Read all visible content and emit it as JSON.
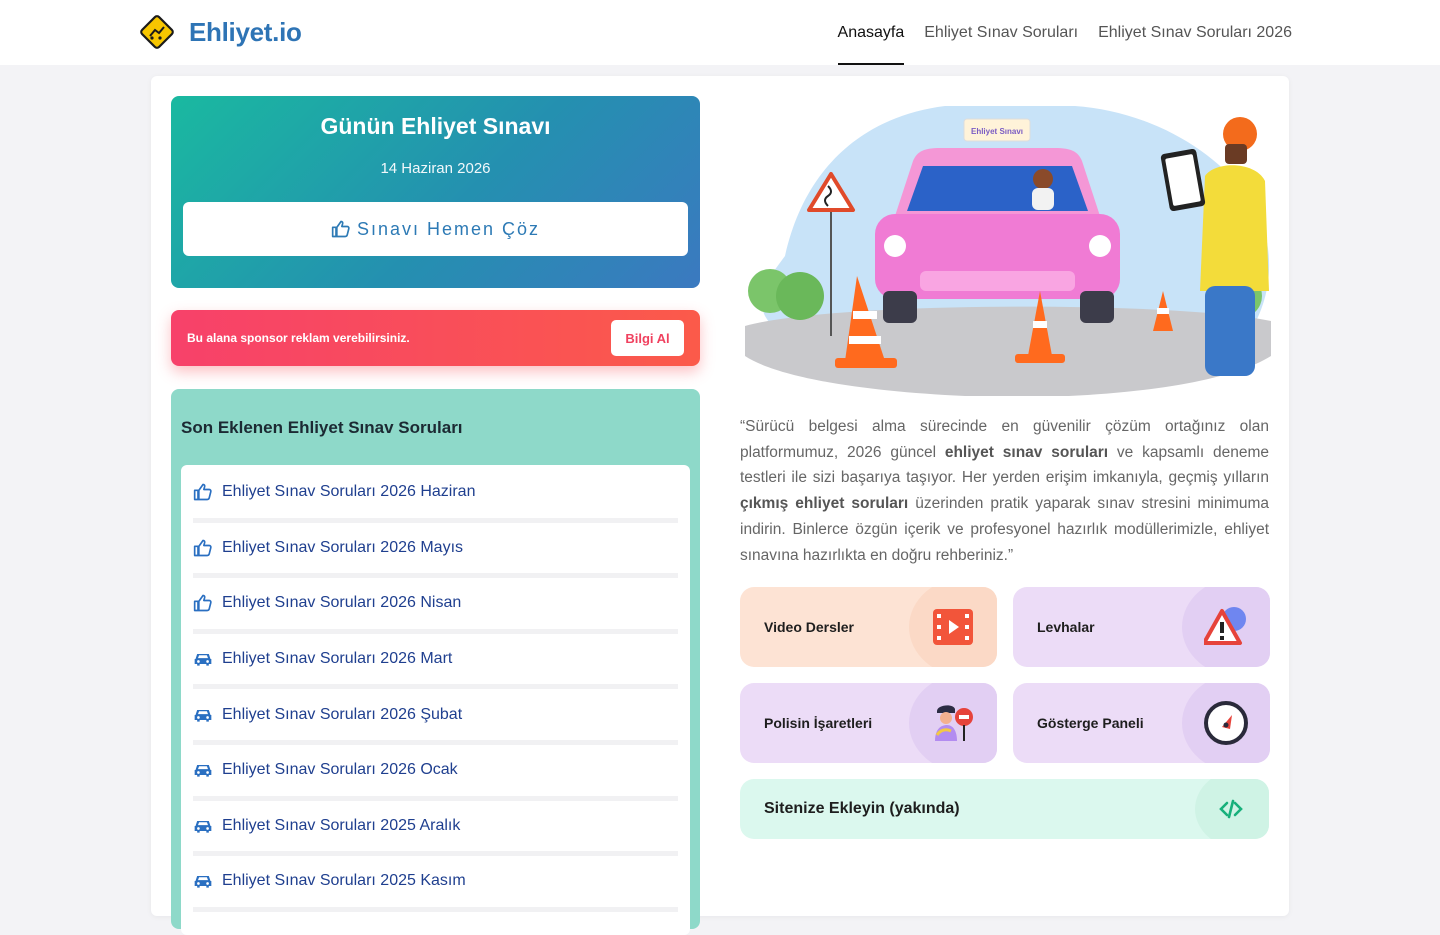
{
  "header": {
    "brand": "Ehliyet.io",
    "nav": [
      {
        "label": "Anasayfa",
        "active": true
      },
      {
        "label": "Ehliyet Sınav Soruları",
        "active": false
      },
      {
        "label": "Ehliyet Sınav Soruları 2026",
        "active": false
      }
    ]
  },
  "daily_exam": {
    "title": "Günün Ehliyet Sınavı",
    "date": "14 Haziran 2026",
    "button_label": "Sınavı Hemen Çöz",
    "button_icon": "thumbs-up-icon"
  },
  "sponsor": {
    "text": "Bu alana sponsor reklam verebilirsiniz.",
    "button_label": "Bilgi Al"
  },
  "latest": {
    "title": "Son Eklenen Ehliyet Sınav Soruları",
    "items": [
      {
        "label": "Ehliyet Sınav Soruları 2026 Haziran",
        "icon": "thumbs-up-icon"
      },
      {
        "label": "Ehliyet Sınav Soruları 2026 Mayıs",
        "icon": "thumbs-up-icon"
      },
      {
        "label": "Ehliyet Sınav Soruları 2026 Nisan",
        "icon": "thumbs-up-icon"
      },
      {
        "label": "Ehliyet Sınav Soruları 2026 Mart",
        "icon": "car-icon"
      },
      {
        "label": "Ehliyet Sınav Soruları 2026 Şubat",
        "icon": "car-icon"
      },
      {
        "label": "Ehliyet Sınav Soruları 2026 Ocak",
        "icon": "car-icon"
      },
      {
        "label": "Ehliyet Sınav Soruları 2025 Aralık",
        "icon": "car-icon"
      },
      {
        "label": "Ehliyet Sınav Soruları 2025 Kasım",
        "icon": "car-icon"
      }
    ]
  },
  "hero": {
    "sign_text": "Ehliyet Sınavı"
  },
  "quote": {
    "p1": "“Sürücü belgesi alma sürecinde en güvenilir çözüm ortağınız olan platformumuz, 2026 güncel ",
    "b1": "ehliyet sınav soruları",
    "p2": " ve kapsamlı deneme testleri ile sizi başarıya taşıyor. Her yerden erişim imkanıyla, geçmiş yılların ",
    "b2": "çıkmış ehliyet soruları",
    "p3": " üzerinden pratik yaparak sınav stresini minimuma indirin. Binlerce özgün içerik ve profesyonel hazırlık modüllerimizle, ehliyet sınavına hazırlıkta en doğru rehberiniz.”"
  },
  "tiles": [
    {
      "label": "Video Dersler",
      "icon": "video-icon"
    },
    {
      "label": "Levhalar",
      "icon": "warning-sign-icon"
    },
    {
      "label": "Polisin İşaretleri",
      "icon": "police-officer-icon"
    },
    {
      "label": "Gösterge Paneli",
      "icon": "speedometer-icon"
    },
    {
      "label": "Sitenize Ekleyin (yakında)",
      "icon": "code-icon"
    }
  ],
  "colors": {
    "brand": "#2e74b5",
    "daily_gradient_start": "#1ab9a0",
    "daily_gradient_end": "#3b79c0",
    "sponsor": "#f7416a",
    "latest_bg": "#8ed9c9",
    "link": "#1f3f8f"
  }
}
